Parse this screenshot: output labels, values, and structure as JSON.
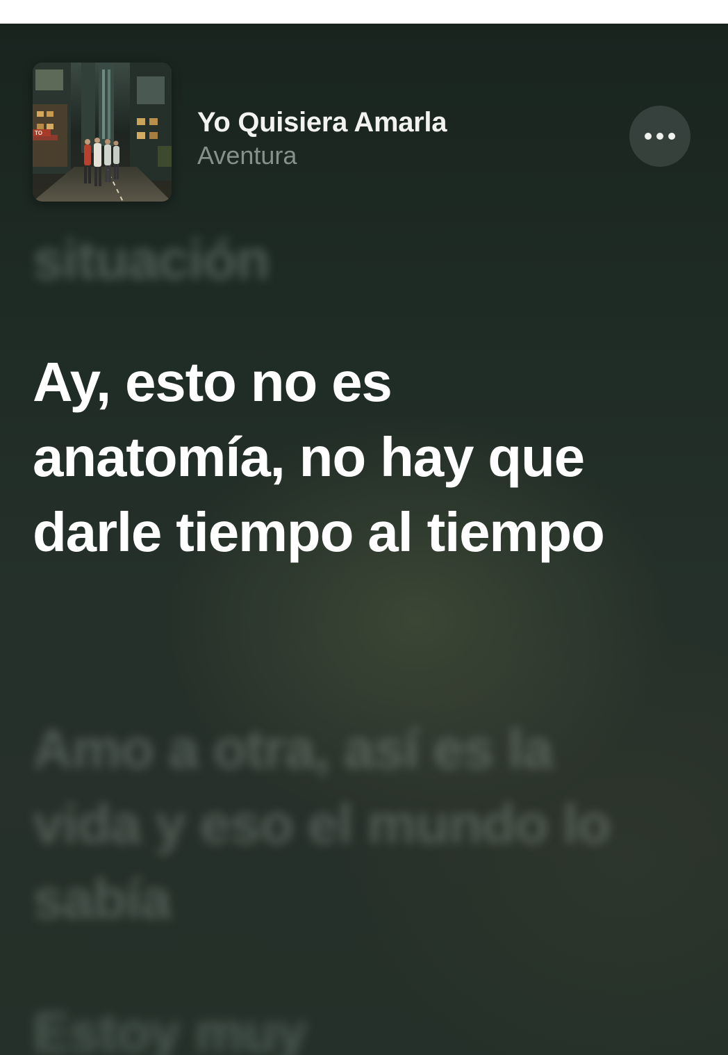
{
  "now_playing": {
    "title": "Yo Quisiera Amarla",
    "artist": "Aventura",
    "more_button_icon": "ellipsis-icon",
    "artwork": {
      "description_icon": "album-artwork-city-street",
      "sign_text": "TO"
    }
  },
  "lyrics": {
    "previous_line": "situación",
    "current_line": "Ay, esto no es anatomía, no hay que darle tiempo al tiempo",
    "next_line": "Amo a otra, así es la vida y eso el mundo lo sabía",
    "following_line": "Estoy muy"
  },
  "colors": {
    "background_top": "#19241f",
    "background_mid": "#25302a",
    "text_active": "#ffffff",
    "text_secondary": "#9aa8a2"
  }
}
